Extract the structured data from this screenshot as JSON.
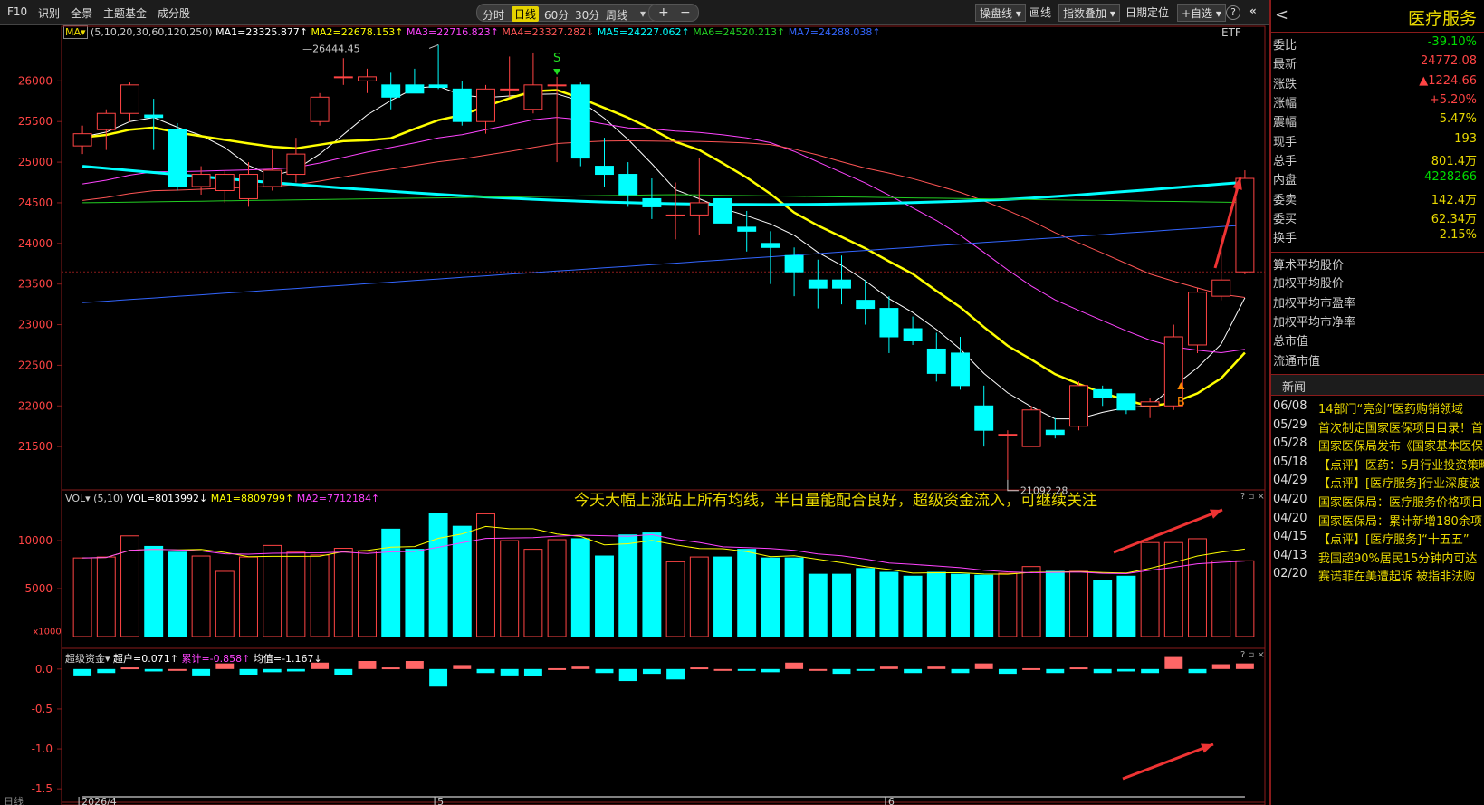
{
  "toolbar": {
    "left": [
      "F10",
      "识别",
      "全景",
      "主题基金",
      "成分股"
    ],
    "periods": [
      "分时",
      "日线",
      "60分",
      "30分",
      "周线"
    ],
    "active_period": "日线",
    "plus": "+",
    "minus": "−",
    "right": [
      "操盘线",
      "画线",
      "指数叠加",
      "日期定位",
      "+自选"
    ],
    "help": "?",
    "collapse": "«"
  },
  "ma_header": {
    "label": "MA",
    "params": "(5,10,20,30,60,120,250)",
    "items": [
      {
        "text": "MA1=23325.877↑",
        "color": "#ffffff"
      },
      {
        "text": "MA2=22678.153↑",
        "color": "#ffff00"
      },
      {
        "text": "MA3=22716.823↑",
        "color": "#ff44ff"
      },
      {
        "text": "MA4=23327.282↓",
        "color": "#ff5555"
      },
      {
        "text": "MA5=24227.062↑",
        "color": "#00ffff"
      },
      {
        "text": "MA6=24520.213↑",
        "color": "#22cc22"
      },
      {
        "text": "MA7=24288.038↑",
        "color": "#3366ff"
      }
    ],
    "etf": "ETF"
  },
  "price_axis": [
    "26000",
    "25500",
    "25000",
    "24500",
    "24000",
    "23500",
    "23000",
    "22500",
    "22000",
    "21500"
  ],
  "high_label": "26444.45",
  "low_label": "21092.28",
  "signal_s": "S",
  "signal_b": "B",
  "annotation": "今天大幅上涨站上所有均线，半日量能配合良好，超级资金流入，可继续关注",
  "vol_header": {
    "label": "VOL",
    "params": "(5,10)",
    "items": [
      {
        "text": "VOL=8013992↓",
        "color": "#ffffff"
      },
      {
        "text": "MA1=8809799↑",
        "color": "#ffff00"
      },
      {
        "text": "MA2=7712184↑",
        "color": "#ff44ff"
      }
    ]
  },
  "vol_axis": [
    "10000",
    "5000"
  ],
  "vol_unit": "x1000",
  "fund_header": {
    "label": "超级资金",
    "items": [
      {
        "text": "超户=0.071↑",
        "color": "#ffffff"
      },
      {
        "text": "累计=-0.858↑",
        "color": "#ff44ff"
      },
      {
        "text": "均值=-1.167↓",
        "color": "#ffffff"
      }
    ]
  },
  "fund_axis": [
    "0.0",
    "-0.5",
    "-1.0",
    "-1.5"
  ],
  "date_labels": [
    "2026/4",
    "5",
    "6"
  ],
  "bottom_label": "日线",
  "panel_ctrl": "? ▫ ×",
  "chart_data": {
    "type": "candlestick",
    "candles": [
      {
        "o": 25200,
        "h": 25450,
        "l": 25100,
        "c": 25350
      },
      {
        "o": 25400,
        "h": 25650,
        "l": 25150,
        "c": 25600
      },
      {
        "o": 25600,
        "h": 25980,
        "l": 25500,
        "c": 25950
      },
      {
        "o": 25580,
        "h": 25780,
        "l": 25150,
        "c": 25550
      },
      {
        "o": 25400,
        "h": 25480,
        "l": 24650,
        "c": 24700
      },
      {
        "o": 24700,
        "h": 24950,
        "l": 24600,
        "c": 24850
      },
      {
        "o": 24650,
        "h": 24900,
        "l": 24500,
        "c": 24850
      },
      {
        "o": 24550,
        "h": 25000,
        "l": 24450,
        "c": 24850
      },
      {
        "o": 24700,
        "h": 25150,
        "l": 24650,
        "c": 24900
      },
      {
        "o": 24850,
        "h": 25300,
        "l": 24750,
        "c": 25100
      },
      {
        "o": 25500,
        "h": 25850,
        "l": 25450,
        "c": 25800
      },
      {
        "o": 26050,
        "h": 26280,
        "l": 25950,
        "c": 26050
      },
      {
        "o": 26000,
        "h": 26150,
        "l": 25850,
        "c": 26050
      },
      {
        "o": 25950,
        "h": 26100,
        "l": 25650,
        "c": 25800
      },
      {
        "o": 25950,
        "h": 26150,
        "l": 25850,
        "c": 25850
      },
      {
        "o": 25950,
        "h": 26444.45,
        "l": 25900,
        "c": 25920
      },
      {
        "o": 25900,
        "h": 26000,
        "l": 25450,
        "c": 25500
      },
      {
        "o": 25500,
        "h": 25950,
        "l": 25350,
        "c": 25900
      },
      {
        "o": 25900,
        "h": 26300,
        "l": 25800,
        "c": 25900
      },
      {
        "o": 25650,
        "h": 26350,
        "l": 25600,
        "c": 25950
      },
      {
        "o": 25950,
        "h": 26050,
        "l": 25000,
        "c": 25950
      },
      {
        "o": 25950,
        "h": 25980,
        "l": 24950,
        "c": 25050
      },
      {
        "o": 24950,
        "h": 25300,
        "l": 24700,
        "c": 24850
      },
      {
        "o": 24850,
        "h": 25000,
        "l": 24450,
        "c": 24600
      },
      {
        "o": 24550,
        "h": 24800,
        "l": 24300,
        "c": 24450
      },
      {
        "o": 24350,
        "h": 24750,
        "l": 24050,
        "c": 24350
      },
      {
        "o": 24350,
        "h": 25050,
        "l": 24100,
        "c": 24500
      },
      {
        "o": 24550,
        "h": 24600,
        "l": 24050,
        "c": 24250
      },
      {
        "o": 24200,
        "h": 24400,
        "l": 23900,
        "c": 24150
      },
      {
        "o": 24000,
        "h": 24150,
        "l": 23500,
        "c": 23950
      },
      {
        "o": 23850,
        "h": 23950,
        "l": 23350,
        "c": 23650
      },
      {
        "o": 23550,
        "h": 23800,
        "l": 23200,
        "c": 23450
      },
      {
        "o": 23550,
        "h": 23850,
        "l": 23250,
        "c": 23450
      },
      {
        "o": 23300,
        "h": 23550,
        "l": 23000,
        "c": 23200
      },
      {
        "o": 23200,
        "h": 23350,
        "l": 22650,
        "c": 22850
      },
      {
        "o": 22950,
        "h": 23100,
        "l": 22750,
        "c": 22800
      },
      {
        "o": 22700,
        "h": 22900,
        "l": 22300,
        "c": 22400
      },
      {
        "o": 22650,
        "h": 22850,
        "l": 22200,
        "c": 22250
      },
      {
        "o": 22000,
        "h": 22250,
        "l": 21500,
        "c": 21700
      },
      {
        "o": 21650,
        "h": 21700,
        "l": 21092.28,
        "c": 21650
      },
      {
        "o": 21500,
        "h": 22000,
        "l": 21500,
        "c": 21950
      },
      {
        "o": 21700,
        "h": 21850,
        "l": 21600,
        "c": 21650
      },
      {
        "o": 21750,
        "h": 22300,
        "l": 21700,
        "c": 22250
      },
      {
        "o": 22200,
        "h": 22250,
        "l": 22000,
        "c": 22100
      },
      {
        "o": 22150,
        "h": 22150,
        "l": 21900,
        "c": 21950
      },
      {
        "o": 22000,
        "h": 22100,
        "l": 21850,
        "c": 22050
      },
      {
        "o": 22000,
        "h": 23000,
        "l": 21950,
        "c": 22850
      },
      {
        "o": 22750,
        "h": 23450,
        "l": 22650,
        "c": 23400
      },
      {
        "o": 23350,
        "h": 24100,
        "l": 23300,
        "c": 23550
      },
      {
        "o": 23650,
        "h": 24900,
        "l": 23620,
        "c": 24800
      }
    ],
    "volumes": [
      8200,
      8300,
      10500,
      9400,
      8800,
      8400,
      6800,
      8300,
      9500,
      8800,
      8500,
      9200,
      8900,
      11200,
      9100,
      12800,
      11500,
      12800,
      10000,
      9100,
      10100,
      10200,
      8400,
      10600,
      10800,
      7800,
      8300,
      8300,
      9100,
      8200,
      8200,
      6500,
      6500,
      7100,
      6700,
      6300,
      6700,
      6500,
      6400,
      6600,
      7300,
      6800,
      6800,
      5900,
      6300,
      9800,
      9800,
      10200,
      7900,
      7900
    ],
    "fund_flow": [
      -0.08,
      -0.05,
      0.02,
      -0.03,
      0.0,
      -0.08,
      0.07,
      -0.07,
      -0.04,
      -0.03,
      0.08,
      -0.07,
      0.1,
      0.02,
      0.1,
      -0.22,
      0.05,
      -0.05,
      -0.08,
      -0.09,
      0.01,
      0.03,
      -0.05,
      -0.15,
      -0.06,
      -0.13,
      0.02,
      0.0,
      -0.02,
      -0.04,
      0.08,
      0.0,
      -0.06,
      -0.02,
      0.03,
      -0.05,
      0.03,
      -0.05,
      0.07,
      -0.06,
      0.01,
      -0.05,
      0.02,
      -0.05,
      -0.03,
      -0.05,
      0.15,
      -0.05,
      0.06,
      0.07
    ]
  },
  "right_panel": {
    "title": "医疗服务",
    "back": "<",
    "quotes": [
      {
        "k": "委比",
        "v": "-39.10%",
        "color": "#00dd00"
      },
      {
        "k": "最新",
        "v": "24772.08",
        "color": "#ff4444"
      },
      {
        "k": "涨跌",
        "v": "▲1224.66",
        "color": "#ff4444"
      },
      {
        "k": "涨幅",
        "v": "+5.20%",
        "color": "#ff4444"
      },
      {
        "k": "震幅",
        "v": "5.47%",
        "color": "#e8d800"
      },
      {
        "k": "现手",
        "v": "193",
        "color": "#e8d800"
      },
      {
        "k": "总手",
        "v": "801.4万",
        "color": "#e8d800"
      },
      {
        "k": "内盘",
        "v": "4228266",
        "color": "#00dd00"
      },
      {
        "k": "委卖",
        "v": "142.4万",
        "color": "#e8d800"
      },
      {
        "k": "委买",
        "v": "62.34万",
        "color": "#e8d800"
      },
      {
        "k": "换手",
        "v": "2.15%",
        "color": "#e8d800"
      }
    ],
    "extra": [
      "算术平均股价",
      "加权平均股价",
      "加权平均市盈率",
      "加权平均市净率",
      "总市值",
      "流通市值"
    ],
    "news_title": "新闻",
    "news": [
      {
        "d": "06/08",
        "t": "14部门“亮剑”医药购销领域"
      },
      {
        "d": "05/29",
        "t": "首次制定国家医保项目目录！首"
      },
      {
        "d": "05/28",
        "t": "国家医保局发布《国家基本医保"
      },
      {
        "d": "05/18",
        "t": "【点评】医药：5月行业投资策略"
      },
      {
        "d": "04/29",
        "t": "【点评】[医疗服务]行业深度波"
      },
      {
        "d": "04/20",
        "t": "国家医保局：医疗服务价格项目"
      },
      {
        "d": "04/20",
        "t": "国家医保局：累计新增180余项"
      },
      {
        "d": "04/15",
        "t": "【点评】[医疗服务]“十五五”"
      },
      {
        "d": "04/13",
        "t": "我国超90%居民15分钟内可达"
      },
      {
        "d": "02/20",
        "t": "赛诺菲在美遭起诉 被指非法购"
      }
    ]
  }
}
